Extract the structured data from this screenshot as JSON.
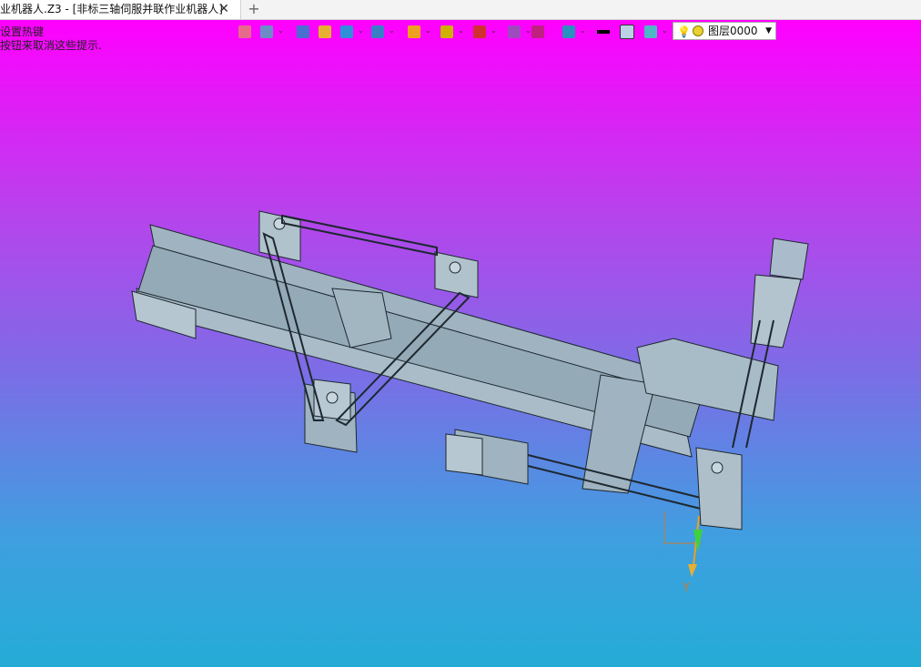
{
  "tab": {
    "title": "业机器人.Z3 - [非标三轴伺服并联作业机器人]",
    "close": "✕"
  },
  "new_tab": "+",
  "hints": [
    "设置热键",
    "按钮来取消这些提示."
  ],
  "toolbar": {
    "layer_label": "图层0000",
    "buttons": [
      {
        "name": "sketch-icon",
        "color": "#e86a8a"
      },
      {
        "name": "part-icon",
        "color": "#6b8cc7"
      },
      {
        "name": "pencil-icon",
        "color": "#4a6fd0"
      },
      {
        "name": "eraser-icon",
        "color": "#e8b030"
      },
      {
        "name": "cube-icon",
        "color": "#2f8fd8"
      },
      {
        "name": "view-cube-icon",
        "color": "#3a7fc6"
      },
      {
        "name": "shading-icon",
        "color": "#f0a020"
      },
      {
        "name": "zoom-icon",
        "color": "#d0b000"
      },
      {
        "name": "pan-icon",
        "color": "#d03030"
      },
      {
        "name": "fit-view-icon",
        "color": "#a04ac0"
      },
      {
        "name": "section-icon",
        "color": "#c02080"
      },
      {
        "name": "display-icon",
        "color": "#2a90c0"
      },
      {
        "name": "line-icon",
        "color": "#000000"
      },
      {
        "name": "color-swatch-icon",
        "color": "#bcd0e6"
      },
      {
        "name": "layer-stack-icon",
        "color": "#4fb6c8"
      }
    ]
  },
  "axis": {
    "label": "Y"
  },
  "colors": {
    "bg_top": "#ff00ff",
    "bg_bottom": "#24acd6",
    "model": "#9fb4c0",
    "edge": "#1e2830"
  }
}
